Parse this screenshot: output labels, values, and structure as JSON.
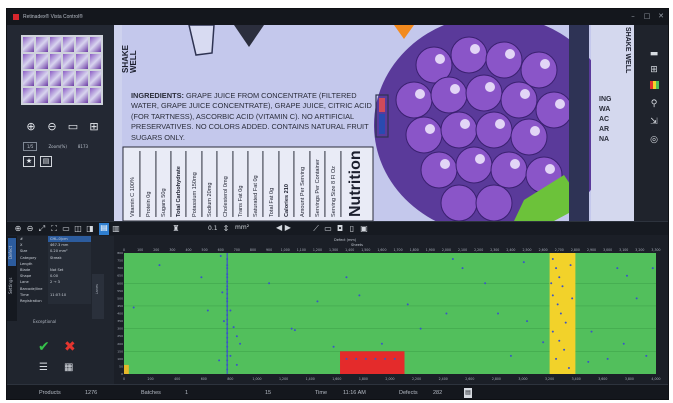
{
  "app": {
    "title": "Retinadex® Vista Control®",
    "minimize": "–",
    "maximize": "□",
    "close": "✕"
  },
  "left_panel": {
    "zoom_label": "Zoom(%)",
    "zoom_value": "8173",
    "page_chip": "1/5",
    "tools": [
      "zoom-in-icon",
      "zoom-out-icon",
      "monitor-icon",
      "grid-icon"
    ]
  },
  "label_image": {
    "shake": "SHAKE WELL",
    "ingredients_heading": "INGREDIENTS:",
    "ingredients_text": "GRAPE JUICE FROM CONCENTRATE (FILTERED WATER, GRAPE JUICE CONCENTRATE), GRAPE JUICE, CITRIC ACID (FOR TARTNESS), ASCORBIC ACID (VITAMIN C). NO ARTIFICIAL PRESERVATIVES. NO COLORS ADDED. CONTAINS NATURAL FRUIT SUGARS ONLY.",
    "nutrition_title": "Nutrition",
    "nutrition_rows": [
      "Serving Size 8 Fl Oz",
      "Servings Per Container",
      "Amount Per Serving",
      "Calories 210",
      "Total Fat 0g",
      "Saturated Fat 0g",
      "Trans Fat 0g",
      "Cholesterol 0mg",
      "Sodium 20mg",
      "Potassium 150mg",
      "Total Carbohydrate",
      "Sugars 50g",
      "Protein 0g",
      "Vitamin C 100%"
    ],
    "right_shake": "SHAKE WELL",
    "right_ingr": "ING\nWA\nAC\nAR\nNA"
  },
  "right_sidebar": {
    "icons": [
      "folder-icon",
      "grid-icon",
      "color-bars-icon",
      "search-icon",
      "export-icon",
      "target-icon"
    ]
  },
  "toolbar": {
    "zoom_value": "0.1",
    "unit": "mm²",
    "step": "◀ ▶"
  },
  "settings": {
    "tabs": [
      "Defect",
      "Settings"
    ],
    "props": [
      {
        "k": "#",
        "v": "CHL-0(cm"
      },
      {
        "k": "X",
        "v": "467.3 mm"
      },
      {
        "k": "Size",
        "v": "0.20 mm²"
      },
      {
        "k": "Category",
        "v": "Streak"
      },
      {
        "k": "Length",
        "v": ""
      },
      {
        "k": "Blade",
        "v": "Not Set"
      },
      {
        "k": "Shape",
        "v": "0.00"
      },
      {
        "k": "Lane",
        "v": "2 → 3"
      },
      {
        "k": "Barcode/line",
        "v": ""
      },
      {
        "k": "Time",
        "v": "11:07:10"
      },
      {
        "k": "Registration",
        "v": ""
      }
    ],
    "exceptional": "Exceptional",
    "strip_label": "Lanes"
  },
  "chart_data": {
    "type": "scatter",
    "title": "Defect (mm)",
    "subtitle": "Sheets",
    "x_ticks_top": [
      "0",
      "100",
      "200",
      "300",
      "400",
      "500",
      "600",
      "700",
      "800",
      "900",
      "1,000",
      "1,100",
      "1,200",
      "1,300",
      "1,400",
      "1,500",
      "1,600",
      "1,700",
      "1,800",
      "1,900",
      "2,000",
      "2,100",
      "2,200",
      "2,300",
      "2,400",
      "2,500",
      "2,600",
      "2,700",
      "2,800",
      "2,900",
      "3,000",
      "3,100",
      "3,200",
      "3,300"
    ],
    "y_ticks": [
      "800",
      "750",
      "700",
      "650",
      "600",
      "550",
      "500",
      "450",
      "400",
      "350",
      "300",
      "250",
      "200",
      "150",
      "100",
      "50",
      "0"
    ],
    "y_label": "Position (mm)",
    "x_ticks_bottom": [
      "0",
      "200",
      "400",
      "600",
      "800",
      "1,000",
      "1,200",
      "1,400",
      "1,600",
      "1,800",
      "2,000",
      "2,200",
      "2,400",
      "2,600",
      "2,800",
      "3,000",
      "3,200",
      "3,400",
      "3,600",
      "3,800",
      "4,000"
    ],
    "background": "#52bf5c",
    "lane_color": "#2d8a3a",
    "dot_color": "#3a54c8",
    "xlim": [
      0,
      3300
    ],
    "ylim": [
      0,
      800
    ],
    "highlight_regions": [
      {
        "name": "repeat-defect-zone",
        "x0": 2640,
        "x1": 2800,
        "y0": 0,
        "y1": 800,
        "color": "#f2d22a"
      },
      {
        "name": "streak-defect-zone",
        "x0": 1340,
        "x1": 1740,
        "y0": 0,
        "y1": 150,
        "color": "#e42b2b"
      },
      {
        "name": "edge-defect-zone",
        "x0": 0,
        "x1": 30,
        "y0": 0,
        "y1": 60,
        "color": "#e6b82a"
      }
    ],
    "vertical_defect_line": {
      "x": 640
    },
    "points": [
      [
        640,
        760
      ],
      [
        640,
        720
      ],
      [
        640,
        700
      ],
      [
        640,
        660
      ],
      [
        640,
        640
      ],
      [
        640,
        610
      ],
      [
        640,
        580
      ],
      [
        640,
        560
      ],
      [
        640,
        530
      ],
      [
        640,
        500
      ],
      [
        640,
        480
      ],
      [
        640,
        450
      ],
      [
        640,
        420
      ],
      [
        640,
        390
      ],
      [
        640,
        360
      ],
      [
        640,
        330
      ],
      [
        640,
        300
      ],
      [
        640,
        270
      ],
      [
        640,
        240
      ],
      [
        640,
        210
      ],
      [
        640,
        180
      ],
      [
        640,
        150
      ],
      [
        640,
        120
      ],
      [
        640,
        90
      ],
      [
        640,
        60
      ],
      [
        640,
        30
      ],
      [
        600,
        780
      ],
      [
        610,
        540
      ],
      [
        620,
        350
      ],
      [
        660,
        420
      ],
      [
        680,
        310
      ],
      [
        700,
        250
      ],
      [
        720,
        200
      ],
      [
        590,
        90
      ],
      [
        660,
        120
      ],
      [
        700,
        60
      ],
      [
        480,
        640
      ],
      [
        520,
        420
      ],
      [
        1060,
        290
      ],
      [
        1040,
        300
      ],
      [
        1300,
        180
      ],
      [
        1380,
        640
      ],
      [
        1460,
        520
      ],
      [
        1760,
        460
      ],
      [
        1840,
        300
      ],
      [
        2040,
        760
      ],
      [
        2240,
        600
      ],
      [
        2320,
        400
      ],
      [
        2480,
        740
      ],
      [
        2500,
        350
      ],
      [
        2600,
        210
      ],
      [
        2900,
        280
      ],
      [
        3060,
        700
      ],
      [
        3120,
        650
      ],
      [
        3180,
        500
      ],
      [
        3240,
        120
      ],
      [
        3280,
        700
      ],
      [
        3100,
        200
      ],
      [
        60,
        440
      ],
      [
        220,
        720
      ],
      [
        900,
        600
      ],
      [
        1600,
        200
      ],
      [
        1200,
        480
      ],
      [
        2000,
        400
      ],
      [
        2100,
        700
      ],
      [
        2400,
        120
      ],
      [
        2880,
        80
      ],
      [
        3000,
        100
      ],
      [
        2660,
        760
      ],
      [
        2680,
        700
      ],
      [
        2700,
        640
      ],
      [
        2720,
        580
      ],
      [
        2660,
        520
      ],
      [
        2690,
        460
      ],
      [
        2710,
        400
      ],
      [
        2740,
        340
      ],
      [
        2660,
        280
      ],
      [
        2700,
        220
      ],
      [
        2730,
        160
      ],
      [
        2680,
        100
      ],
      [
        2760,
        40
      ],
      [
        2770,
        720
      ],
      [
        2650,
        600
      ],
      [
        2780,
        500
      ],
      [
        1380,
        100
      ],
      [
        1440,
        100
      ],
      [
        1500,
        100
      ],
      [
        1560,
        100
      ],
      [
        1620,
        100
      ],
      [
        1680,
        100
      ]
    ]
  },
  "status": {
    "products_label": "Products",
    "products_value": "1276",
    "batches_label": "Batches",
    "batches_value": "1",
    "runs_value": "15",
    "time_label": "Time",
    "time_value": "11:16 AM",
    "defects_label": "Defects",
    "defects_value": "282"
  }
}
